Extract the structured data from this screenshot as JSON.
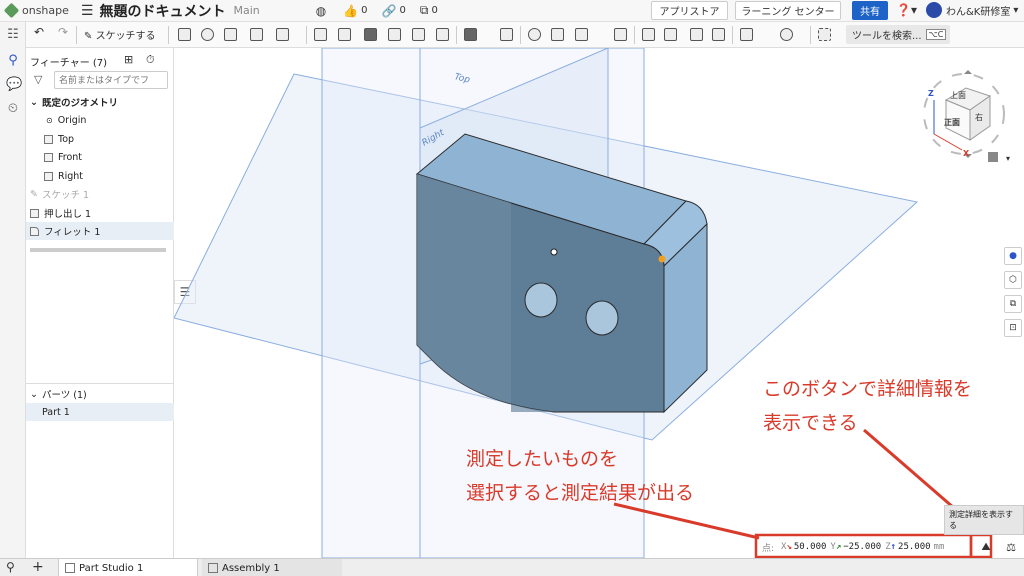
{
  "app": {
    "logo": "onshape",
    "title": "無題のドキュメント",
    "workspace": "Main"
  },
  "topbar": {
    "likes": "0",
    "links": "0",
    "copies": "0",
    "app_store": "アプリストア",
    "learning": "ラーニング センター",
    "share": "共有",
    "help": "?",
    "user": "わん&K研修室"
  },
  "toolbar": {
    "sketch": "スケッチする",
    "tool_search": "ツールを検索...",
    "shortcut": "⌥C"
  },
  "features": {
    "header": "フィーチャー (7)",
    "filter_placeholder": "名前またはタイプでフ",
    "default_geometry": "既定のジオメトリ",
    "origin": "Origin",
    "top": "Top",
    "front": "Front",
    "right": "Right",
    "sketch": "スケッチ 1",
    "extrude": "押し出し 1",
    "fillet": "フィレット 1"
  },
  "parts": {
    "header": "パーツ (1)",
    "part": "Part 1"
  },
  "viewport": {
    "plane_top": "Top",
    "plane_right": "Right"
  },
  "viewcube": {
    "top": "上面",
    "front": "正面",
    "right": "右",
    "z": "Z",
    "x": "X"
  },
  "measure": {
    "label": "点:",
    "x_label": "X",
    "x": "50.000",
    "y_label": "Y",
    "y": "−25.000",
    "z_label": "Z",
    "z": "25.000",
    "unit": "mm"
  },
  "tooltip": "測定詳細を表示する",
  "annotations": {
    "button_line1": "このボタンで詳細情報を",
    "button_line2": "表示できる",
    "measure_line1": "測定したいものを",
    "measure_line2": "選択すると測定結果が出る"
  },
  "tabs": {
    "part_studio": "Part Studio 1",
    "assembly": "Assembly 1"
  },
  "colors": {
    "accent": "#1e63c8",
    "annotation": "#d93b2b",
    "part": "#6f8faa",
    "plane": "#8aaee0"
  }
}
